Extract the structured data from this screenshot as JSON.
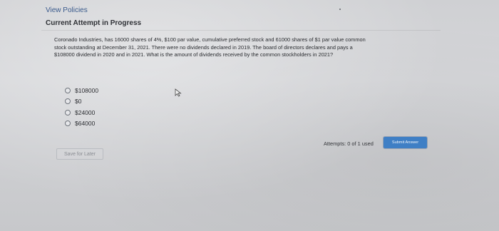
{
  "header": {
    "view_policies": "View Policies",
    "status": "Current Attempt in Progress"
  },
  "question": {
    "line1": "Coronado Industries, has 16000 shares of 4%, $100 par value, cumulative preferred stock and 61000 shares of $1 par value common",
    "line2": "stock outstanding at December 31, 2021. There were no dividends declared in 2019. The board of directors declares and pays a",
    "line3": "$108000 dividend in 2020 and in 2021. What is the amount of dividends received by the common stockholders in 2021?"
  },
  "options": [
    {
      "label": "$108000"
    },
    {
      "label": "$0"
    },
    {
      "label": "$24000"
    },
    {
      "label": "$64000"
    }
  ],
  "footer": {
    "attempts": "Attempts: 0 of 1 used",
    "submit_label": "Submit Answer",
    "save_label": "Save for Later"
  },
  "icons": {
    "cursor": "mouse-pointer-icon",
    "radio": "radio-unchecked-icon"
  }
}
